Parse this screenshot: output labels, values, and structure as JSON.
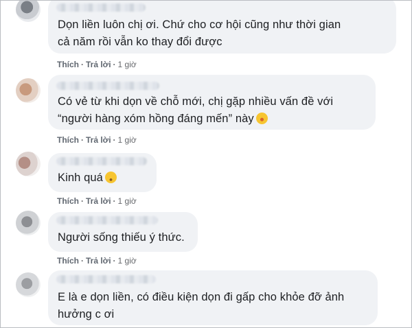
{
  "comments": [
    {
      "text": "Dọn liền luôn chị ơi. Chứ cho cơ hội cũng như thời gian\ncả năm rồi vẫn ko thay đổi được",
      "actions": {
        "like": "Thích",
        "reply": "Trả lời",
        "time": "1 giờ"
      }
    },
    {
      "text": "Có vẻ từ khi dọn về chỗ mới, chị gặp nhiều vấn đề với\n“người hàng xóm hồng đáng mến” này",
      "emoji": "laughing-tears-emoji",
      "actions": {
        "like": "Thích",
        "reply": "Trả lời",
        "time": "1 giờ"
      }
    },
    {
      "text": "Kinh quá",
      "emoji": "disappointed-face-emoji",
      "actions": {
        "like": "Thích",
        "reply": "Trả lời",
        "time": "1 giờ"
      }
    },
    {
      "text": "Người sống thiếu ý thức.",
      "actions": {
        "like": "Thích",
        "reply": "Trả lời",
        "time": "1 giờ"
      }
    },
    {
      "text": "E là e dọn liền, có điều kiện dọn đi gấp cho khỏe đỡ ảnh\nhưởng c ơi"
    }
  ],
  "colors": {
    "bubble": "#f0f2f5",
    "text": "#1c1e21",
    "meta": "#65676b",
    "emoji_yellow": "#f7c531"
  }
}
